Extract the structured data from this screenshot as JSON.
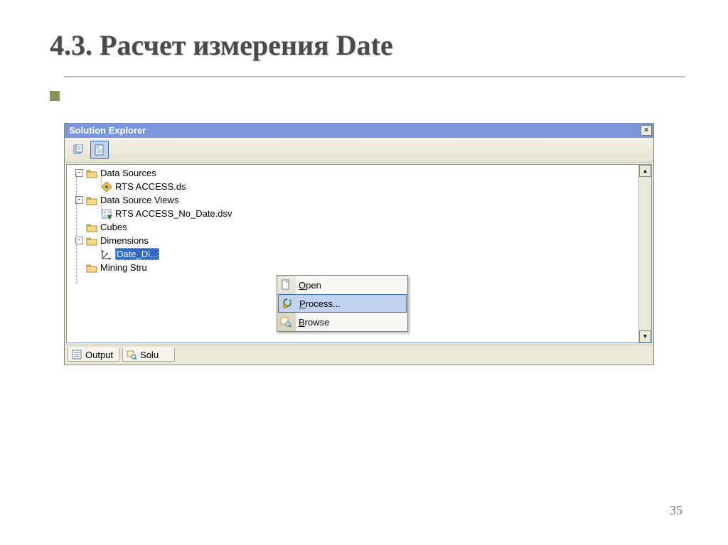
{
  "slide": {
    "title": "4.3. Расчет измерения Date",
    "page_number": "35"
  },
  "solution_explorer": {
    "title": "Solution Explorer",
    "tree": {
      "data_sources": {
        "label": "Data Sources",
        "item": "RTS ACCESS.ds"
      },
      "data_source_views": {
        "label": "Data Source Views",
        "item": "RTS ACCESS_No_Date.dsv"
      },
      "cubes": {
        "label": "Cubes"
      },
      "dimensions": {
        "label": "Dimensions",
        "selected_item": "Date_Di..."
      },
      "mining_structures": {
        "label": "Mining Stru"
      }
    },
    "tabs": {
      "output": "Output",
      "solution": "Solu"
    }
  },
  "context_menu": {
    "open": "Open",
    "process": "Process...",
    "browse": "Browse"
  }
}
